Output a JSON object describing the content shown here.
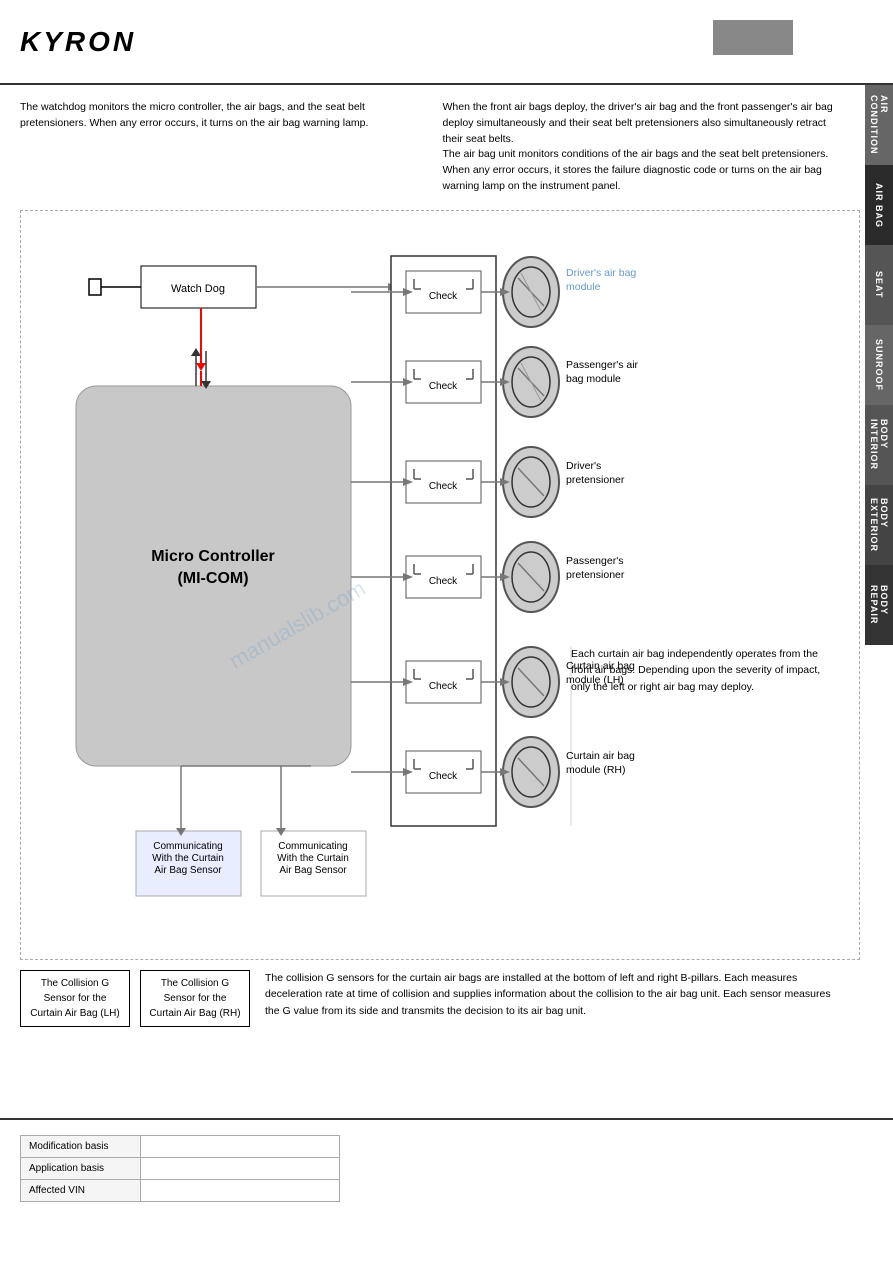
{
  "header": {
    "logo": "KYRON"
  },
  "sidebar": {
    "tabs": [
      {
        "label": "AIR\nCONDITION",
        "class": "tab-air-cond"
      },
      {
        "label": "AIR BAG",
        "class": "tab-air-bag"
      },
      {
        "label": "SEAT",
        "class": "tab-seat"
      },
      {
        "label": "SUNROOF",
        "class": "tab-sunroof"
      },
      {
        "label": "BODY\nINTERIOR",
        "class": "tab-body-int"
      },
      {
        "label": "BODY\nEXTERIOR",
        "class": "tab-body-ext"
      },
      {
        "label": "BODY\nREPAIR",
        "class": "tab-body-rep"
      }
    ]
  },
  "intro": {
    "left": "The watchdog monitors the micro controller, the air bags, and the seat belt pretensioners. When any error occurs, it turns on the air bag warning lamp.",
    "right": "When the front air bags deploy, the driver's air bag and the front passenger's air bag deploy simultaneously and their seat belt pretensioners also simultaneously retract their seat belts.\nThe air bag unit monitors conditions of the air bags and the seat belt pretensioners. When any error occurs, it stores the failure diagnostic code or turns on the air bag warning lamp on the instrument panel."
  },
  "diagram": {
    "watchdog_label": "Watch Dog",
    "micom_label": "Micro Controller\n(MI-COM)",
    "check_label": "Check",
    "modules": [
      {
        "label": "Driver's air bag\nmodule",
        "color": "blue"
      },
      {
        "label": "Passenger's air\nbag module",
        "color": "black"
      },
      {
        "label": "Driver's\npretensioner",
        "color": "black"
      },
      {
        "label": "Passenger's\npretensioner",
        "color": "black"
      },
      {
        "label": "Curtain air bag\nmodule (LH)",
        "color": "black"
      },
      {
        "label": "Curtain air bag\nmodule (RH)",
        "color": "black"
      }
    ],
    "comm_boxes": [
      {
        "label": "Communicating\nWith the Curtain\nAir Bag Sensor"
      },
      {
        "label": "Communicating\nWith the Curtain\nAir Bag Sensor"
      }
    ],
    "collision_boxes": [
      {
        "label": "The Collision G\nSensor for the\nCurtain Air Bag (LH)"
      },
      {
        "label": "The Collision G\nSensor for the\nCurtain Air Bag (RH)"
      }
    ],
    "curtain_text": "Each curtain air bag independently operates from the front air bags. Depending upon the severity of impact, only the left or right air bag may deploy.",
    "collision_text": "The collision G sensors for the curtain air bags are installed at the bottom of left and right B-pillars. Each measures deceleration rate at time of collision and supplies information about the collision to the air bag unit. Each sensor measures the G value from its side and transmits the decision to its air bag unit."
  },
  "footer": {
    "rows": [
      {
        "label": "Modification basis",
        "value": ""
      },
      {
        "label": "Application basis",
        "value": ""
      },
      {
        "label": "Affected VIN",
        "value": ""
      }
    ]
  }
}
